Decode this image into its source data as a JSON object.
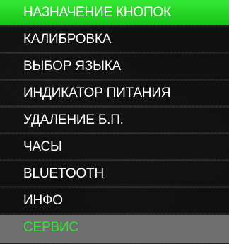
{
  "menu": {
    "items": [
      {
        "label": "НАЗНАЧЕНИЕ КНОПОК"
      },
      {
        "label": "КАЛИБРОВКА"
      },
      {
        "label": "ВЫБОР ЯЗЫКА"
      },
      {
        "label": "ИНДИКАТОР ПИТАНИЯ"
      },
      {
        "label": "УДАЛЕНИЕ Б.П."
      },
      {
        "label": "ЧАСЫ"
      },
      {
        "label": "BLUETOOTH"
      },
      {
        "label": "ИНФО"
      },
      {
        "label": "СЕРВИС"
      }
    ],
    "selected_index": 0
  },
  "colors": {
    "selected_bg": "#22d022",
    "item_bg": "#0a0a0a",
    "item_text": "#ffffff",
    "last_bg": "#6e6e6e",
    "last_text": "#2fe82f"
  }
}
